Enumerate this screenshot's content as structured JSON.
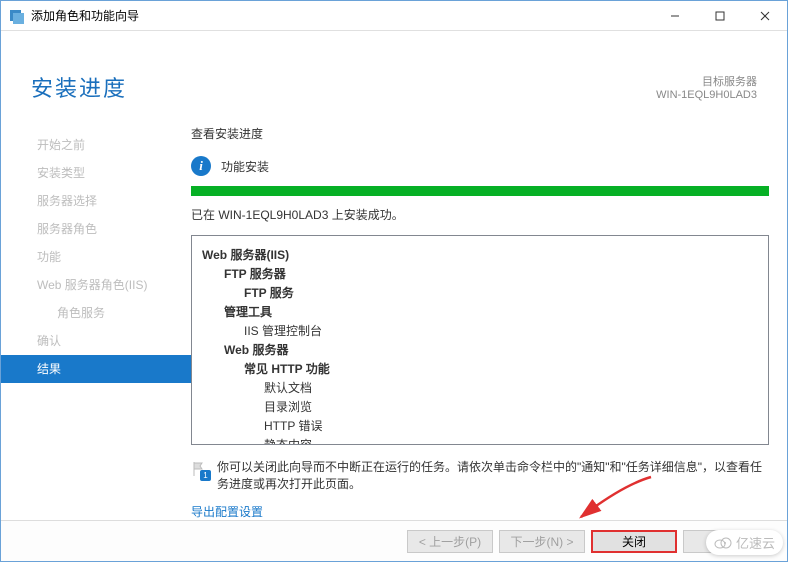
{
  "window": {
    "title": "添加角色和功能向导",
    "controls": {
      "minimize": "─",
      "maximize": "☐",
      "close": "✕"
    }
  },
  "header": {
    "page_title": "安装进度",
    "target_label": "目标服务器",
    "target_value": "WIN-1EQL9H0LAD3"
  },
  "sidebar": {
    "items": [
      {
        "label": "开始之前",
        "active": false,
        "sub": false
      },
      {
        "label": "安装类型",
        "active": false,
        "sub": false
      },
      {
        "label": "服务器选择",
        "active": false,
        "sub": false
      },
      {
        "label": "服务器角色",
        "active": false,
        "sub": false
      },
      {
        "label": "功能",
        "active": false,
        "sub": false
      },
      {
        "label": "Web 服务器角色(IIS)",
        "active": false,
        "sub": false
      },
      {
        "label": "角色服务",
        "active": false,
        "sub": true
      },
      {
        "label": "确认",
        "active": false,
        "sub": false
      },
      {
        "label": "结果",
        "active": true,
        "sub": false
      }
    ]
  },
  "main": {
    "view_title": "查看安装进度",
    "info_badge": "i",
    "info_text": "功能安装",
    "success_text": "已在 WIN-1EQL9H0LAD3 上安装成功。",
    "results": [
      {
        "cls": "r0",
        "text": "Web 服务器(IIS)"
      },
      {
        "cls": "r1",
        "text": "FTP 服务器"
      },
      {
        "cls": "r2",
        "text": "FTP 服务"
      },
      {
        "cls": "r1",
        "text": "管理工具"
      },
      {
        "cls": "r2n",
        "text": "IIS 管理控制台"
      },
      {
        "cls": "r1",
        "text": "Web 服务器"
      },
      {
        "cls": "r2",
        "text": "常见 HTTP 功能"
      },
      {
        "cls": "r3n",
        "text": "默认文档"
      },
      {
        "cls": "r3n",
        "text": "目录浏览"
      },
      {
        "cls": "r3n",
        "text": "HTTP 错误"
      },
      {
        "cls": "r3n",
        "text": "静态内容"
      }
    ],
    "note_text": "你可以关闭此向导而不中断正在运行的任务。请依次单击命令栏中的\"通知\"和\"任务详细信息\"，以查看任务进度或再次打开此页面。",
    "note_badge": "1",
    "export_link": "导出配置设置"
  },
  "footer": {
    "previous": "< 上一步(P)",
    "next": "下一步(N) >",
    "close": "关闭",
    "cancel": "取消"
  },
  "watermark": "亿速云"
}
